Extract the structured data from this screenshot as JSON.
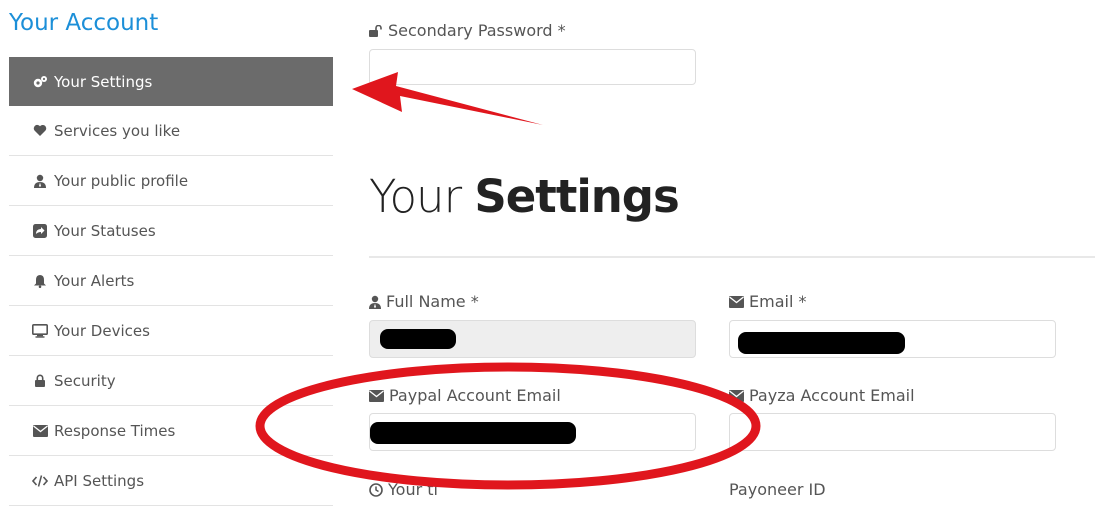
{
  "sidebar": {
    "title": "Your Account",
    "items": [
      {
        "label": "Your Settings",
        "icon": "gears-icon",
        "active": true
      },
      {
        "label": "Services you like",
        "icon": "heart-icon",
        "active": false
      },
      {
        "label": "Your public profile",
        "icon": "user-tie-icon",
        "active": false
      },
      {
        "label": "Your Statuses",
        "icon": "share-icon",
        "active": false
      },
      {
        "label": "Your Alerts",
        "icon": "bell-icon",
        "active": false
      },
      {
        "label": "Your Devices",
        "icon": "monitor-icon",
        "active": false
      },
      {
        "label": "Security",
        "icon": "lock-icon",
        "active": false
      },
      {
        "label": "Response Times",
        "icon": "envelope-icon",
        "active": false
      },
      {
        "label": "API Settings",
        "icon": "code-icon",
        "active": false
      }
    ]
  },
  "form": {
    "secondary_password_label": "Secondary Password *",
    "secondary_password_value": "",
    "heading_light": "Your ",
    "heading_bold": "Settings",
    "full_name_label": "Full Name *",
    "email_label": "Email *",
    "paypal_label": "Paypal Account Email",
    "payza_label": "Payza Account Email",
    "payza_value": "",
    "payoneer_label": "Payoneer ID",
    "time_label": "Your ti"
  },
  "colors": {
    "accent": "#1c8fd8",
    "active_bg": "#6b6b6b",
    "annotation_red": "#e0161d"
  }
}
